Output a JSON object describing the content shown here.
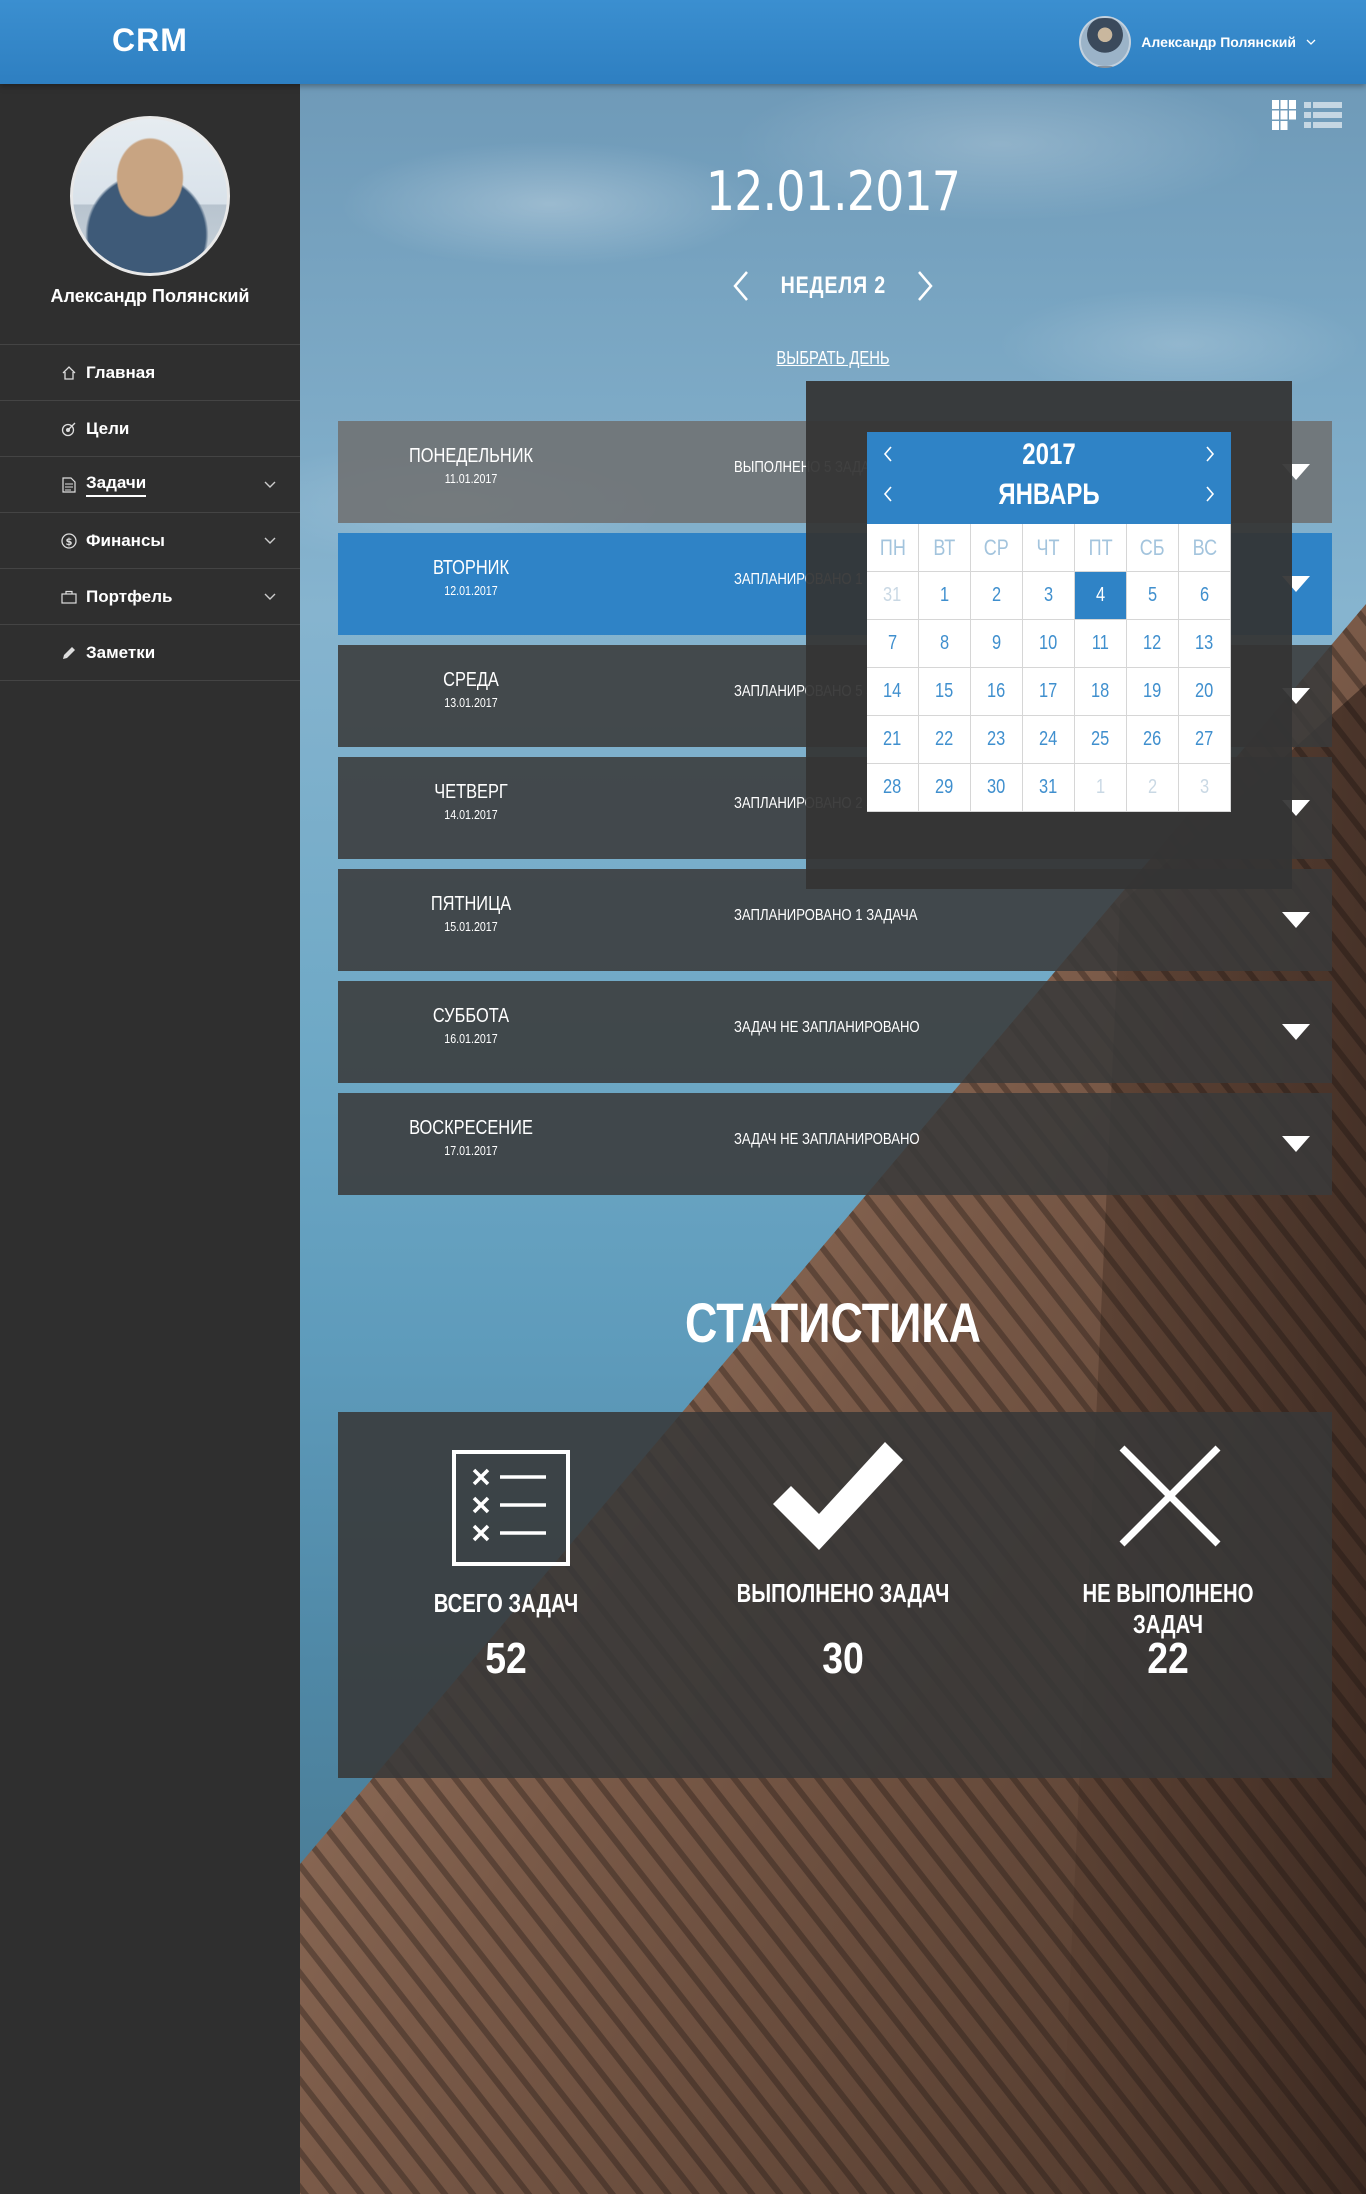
{
  "app": {
    "logo": "CRM"
  },
  "header": {
    "user_name": "Александр Полянский"
  },
  "sidebar": {
    "profile_name": "Александр Полянский",
    "items": [
      {
        "label": "Главная",
        "icon": "home-icon",
        "has_submenu": false,
        "active": false
      },
      {
        "label": "Цели",
        "icon": "target-icon",
        "has_submenu": false,
        "active": false
      },
      {
        "label": "Задачи",
        "icon": "document-icon",
        "has_submenu": true,
        "active": true
      },
      {
        "label": "Финансы",
        "icon": "dollar-icon",
        "has_submenu": true,
        "active": false
      },
      {
        "label": "Портфель",
        "icon": "briefcase-icon",
        "has_submenu": true,
        "active": false
      },
      {
        "label": "Заметки",
        "icon": "pencil-icon",
        "has_submenu": false,
        "active": false
      }
    ]
  },
  "main": {
    "date": "12.01.2017",
    "week_label": "НЕДЕЛЯ 2",
    "pick_day": "ВЫБРАТЬ ДЕНЬ",
    "days": [
      {
        "name": "ПОНЕДЕЛЬНИК",
        "date": "11.01.2017",
        "status": "ВЫПОЛНЕНО 5 ЗАДАЧ"
      },
      {
        "name": "ВТОРНИК",
        "date": "12.01.2017",
        "status": "ЗАПЛАНИРОВАНО 1"
      },
      {
        "name": "СРЕДА",
        "date": "13.01.2017",
        "status": "ЗАПЛАНИРОВАНО 5 З"
      },
      {
        "name": "ЧЕТВЕРГ",
        "date": "14.01.2017",
        "status": "ЗАПЛАНИРОВАНО 2 З"
      },
      {
        "name": "ПЯТНИЦА",
        "date": "15.01.2017",
        "status": "ЗАПЛАНИРОВАНО 1 ЗАДАЧА"
      },
      {
        "name": "СУББОТА",
        "date": "16.01.2017",
        "status": "ЗАДАЧ НЕ ЗАПЛАНИРОВАНО"
      },
      {
        "name": "ВОСКРЕСЕНИЕ",
        "date": "17.01.2017",
        "status": "ЗАДАЧ НЕ ЗАПЛАНИРОВАНО"
      }
    ]
  },
  "calendar": {
    "year": "2017",
    "month": "ЯНВАРЬ",
    "weekdays": [
      "ПН",
      "ВТ",
      "СР",
      "ЧТ",
      "ПТ",
      "СБ",
      "ВС"
    ],
    "cells": [
      "31",
      "1",
      "2",
      "3",
      "4",
      "5",
      "6",
      "7",
      "8",
      "9",
      "10",
      "11",
      "12",
      "13",
      "14",
      "15",
      "16",
      "17",
      "18",
      "19",
      "20",
      "21",
      "22",
      "23",
      "24",
      "25",
      "26",
      "27",
      "28",
      "29",
      "30",
      "31",
      "1",
      "2",
      "3"
    ],
    "muted_indices": [
      0,
      32,
      33,
      34
    ],
    "selected_index": 4
  },
  "stats": {
    "title": "СТАТИСТИКА",
    "items": [
      {
        "label": "ВСЕГО ЗАДАЧ",
        "value": "52",
        "icon": "checklist-icon"
      },
      {
        "label": "ВЫПОЛНЕНО ЗАДАЧ",
        "value": "30",
        "icon": "checkmark-icon"
      },
      {
        "label": "НЕ ВЫПОЛНЕНО ЗАДАЧ",
        "value": "22",
        "icon": "cross-icon"
      }
    ]
  },
  "colors": {
    "accent": "#2f83c6",
    "header": "#3288c9",
    "sidebar": "#2f2f2f"
  }
}
